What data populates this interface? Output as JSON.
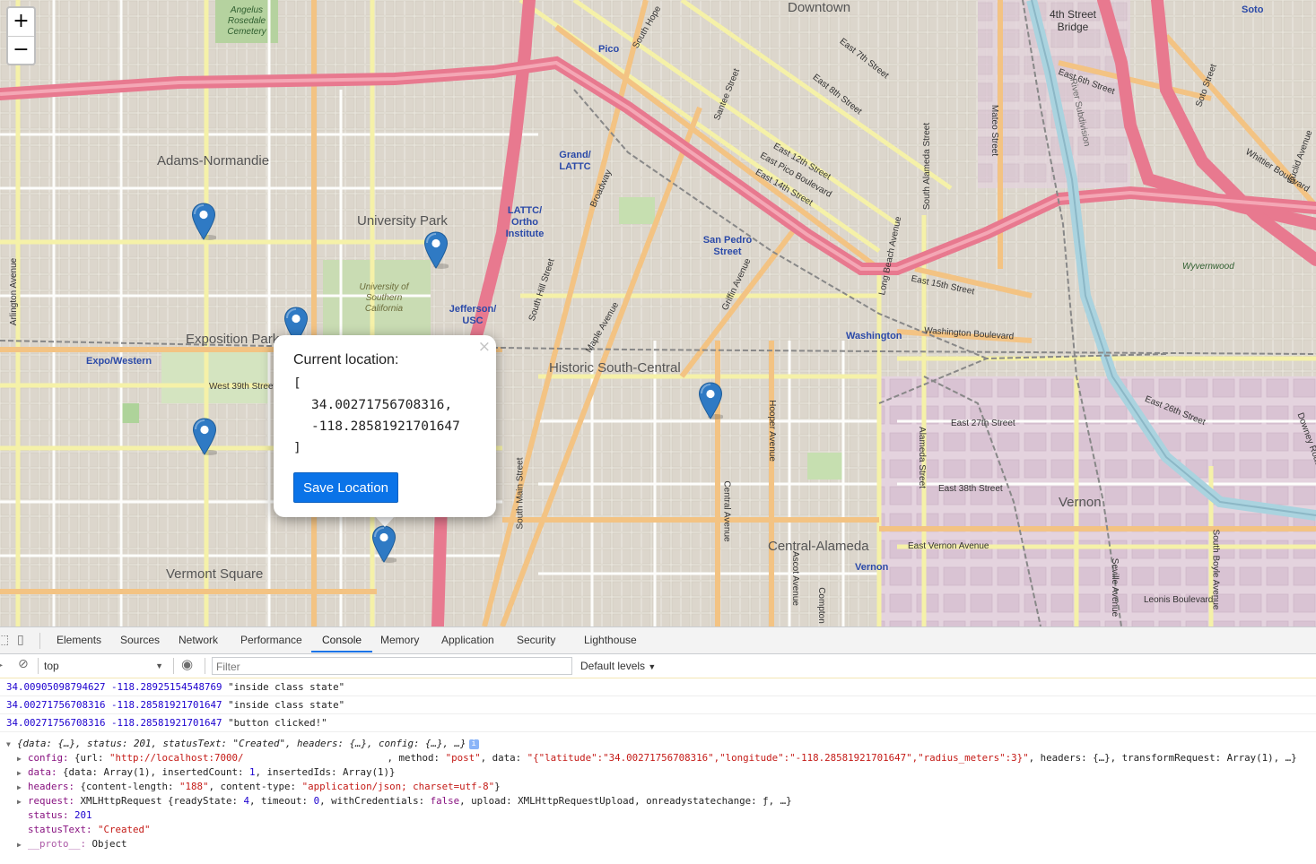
{
  "map": {
    "zoom_in": "+",
    "zoom_out": "−",
    "area_labels": [
      "Downtown",
      "Adams-Normandie",
      "University Park",
      "Exposition Park",
      "Historic South-Central",
      "Vermont Square",
      "Central-Alameda",
      "Vernon",
      "Wyvernwood"
    ],
    "station_labels": [
      "Pico",
      "Grand/ LATTC",
      "LATTC/ Ortho Institute",
      "Jefferson/ USC",
      "Expo/Western",
      "San Pedro Street",
      "Washington",
      "Vernon",
      "Soto"
    ],
    "street_labels": [
      "West 39th Street",
      "4th Street Bridge",
      "East 6th Street",
      "East 7th Street",
      "East 8th Street",
      "East 12th Street",
      "East Pico Boulevard",
      "East 14th Street",
      "East 15th Street",
      "Washington Boulevard",
      "East 26th Street",
      "East 27th Street",
      "East 38th Street",
      "East Vernon Avenue",
      "Leonis Boulevard",
      "Santee Street",
      "Broadway",
      "South Hill Street",
      "Maple Avenue",
      "Griffin Avenue",
      "Central Avenue",
      "Hooper Avenue",
      "Ascot Avenue",
      "Compton",
      "Alameda Street",
      "South Alameda Street",
      "Long Beach Avenue",
      "Mateo Street",
      "River Subdivision",
      "Soto Street",
      "Euclid Avenue",
      "Whittier Boulevard",
      "Arlington Avenue",
      "South Main Street",
      "Seville Avenue",
      "South Boyle Avenue",
      "Downey Road",
      "South Hope",
      "Angelus Rosedale Cemetery",
      "University of Southern California"
    ],
    "popup": {
      "title": "Current location:",
      "open_bracket": "[",
      "lat": "34.00271756708316,",
      "lng": "-118.28581921701647",
      "close_bracket": "]",
      "close_symbol": "×",
      "button_label": "Save Location"
    },
    "marker_color": "#2f7ac4"
  },
  "devtools": {
    "tabs": [
      "Elements",
      "Sources",
      "Network",
      "Performance",
      "Console",
      "Memory",
      "Application",
      "Security",
      "Lighthouse"
    ],
    "active_tab": "Console",
    "context": "top",
    "filter_placeholder": "Filter",
    "levels": "Default levels",
    "logs": [
      {
        "lat": "34.00905098794627",
        "lng": "-118.28925154548769",
        "msg": "\"inside class state\""
      },
      {
        "lat": "34.00271756708316",
        "lng": "-118.28581921701647",
        "msg": "\"inside class state\""
      },
      {
        "lat": "34.00271756708316",
        "lng": "-118.28581921701647",
        "msg": "\"button clicked!\""
      }
    ],
    "object_summary": "{data: {…}, status: 201, statusText: \"Created\", headers: {…}, config: {…}, …}",
    "object_info_badge": "i",
    "config_line": {
      "key": "config:",
      "pre": " {url: ",
      "url": "\"http://localhost:7000/",
      "mid": ", method: ",
      "method": "\"post\"",
      "data_key": ", data: ",
      "data": "\"{\"latitude\":\"34.00271756708316\",\"longitude\":\"-118.28581921701647\",\"radius_meters\":3}\"",
      "tail": ", headers: {…}, transformRequest: Array(1), …}"
    },
    "data_line": {
      "key": "data:",
      "pre": " {data: Array(1), insertedCount: ",
      "count": "1",
      "tail": ", insertedIds: Array(1)}"
    },
    "headers_line": {
      "key": "headers:",
      "pre": " {content-length: ",
      "len": "\"188\"",
      "mid": ", content-type: ",
      "ctype": "\"application/json; charset=utf-8\"",
      "tail": "}"
    },
    "request_line": {
      "key": "request:",
      "pre": " XMLHttpRequest {readyState: ",
      "rs": "4",
      "mid": ", timeout: ",
      "to": "0",
      "mid2": ", withCredentials: ",
      "wc": "false",
      "tail": ", upload: XMLHttpRequestUpload, onreadystatechange: ƒ, …}"
    },
    "status_line": {
      "key": "status:",
      "val": "201"
    },
    "statustext_line": {
      "key": "statusText:",
      "val": "\"Created\""
    },
    "proto_line": {
      "key": "__proto__:",
      "val": " Object"
    }
  }
}
